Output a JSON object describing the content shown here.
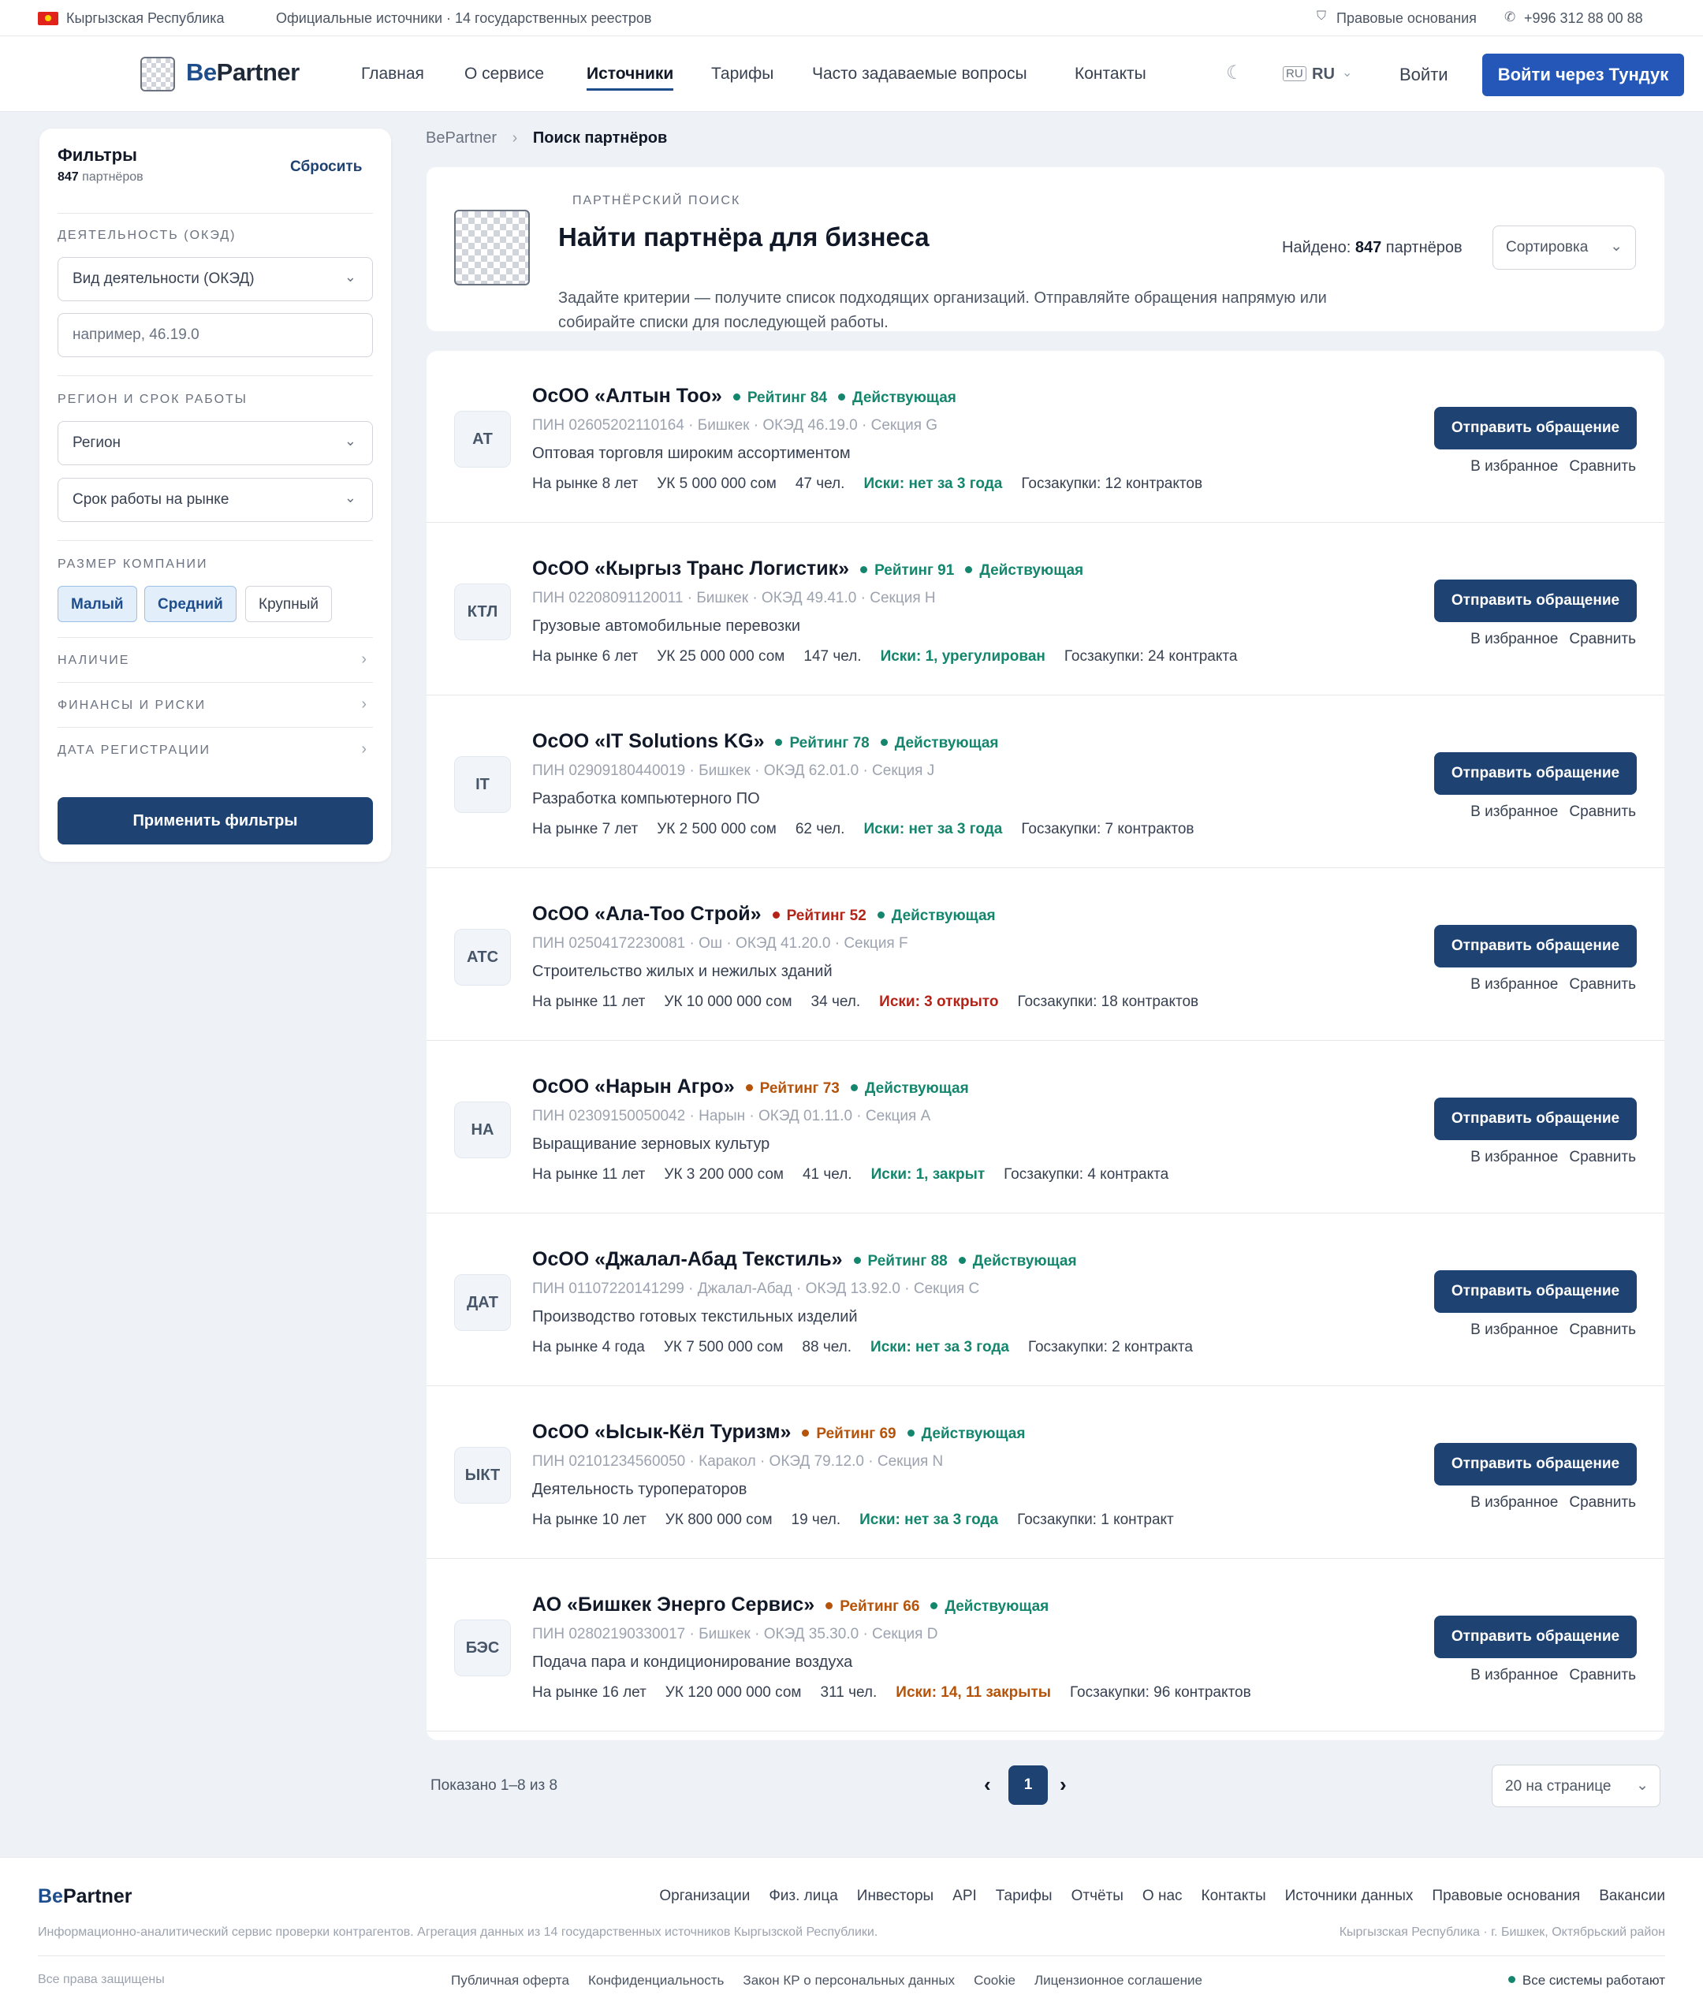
{
  "topbar": {
    "country": "Кыргызская Республика",
    "sources": "Официальные источники · 14 государственных реестров",
    "legal": "Правовые основания",
    "phone": "+996 312 88 00 88"
  },
  "header": {
    "logo_be": "Be",
    "logo_partner": "Partner",
    "nav": [
      "Главная",
      "О сервисе",
      "Источники",
      "Тарифы",
      "Часто задаваемые вопросы",
      "Контакты"
    ],
    "lang": "RU",
    "login": "Войти",
    "login_tunduk": "Войти через Тундук"
  },
  "filters": {
    "title": "Фильтры",
    "count_num": "847",
    "count_label": "партнёров",
    "reset": "Сбросить",
    "section_activity": "ДЕЯТЕЛЬНОСТЬ (ОКЭД)",
    "activity_select": "Вид деятельности (ОКЭД)",
    "activity_placeholder": "например, 46.19.0",
    "section_region": "РЕГИОН И СРОК РАБОТЫ",
    "region_select": "Регион",
    "term_select": "Срок работы на рынке",
    "section_size": "РАЗМЕР КОМПАНИИ",
    "sizes": [
      "Малый",
      "Средний",
      "Крупный"
    ],
    "acc_availability": "НАЛИЧИЕ",
    "acc_finance": "ФИНАНСЫ И РИСКИ",
    "acc_date": "ДАТА РЕГИСТРАЦИИ",
    "apply": "Применить фильтры"
  },
  "breadcrumb": {
    "root": "BePartner",
    "current": "Поиск партнёров"
  },
  "search_head": {
    "eyebrow": "ПАРТНЁРСКИЙ ПОИСК",
    "title": "Найти партнёра для бизнеса",
    "found_label": "Найдено:",
    "found_num": "847",
    "found_unit": "партнёров",
    "sort": "Сортировка",
    "desc_line1": "Задайте критерии — получите список подходящих организаций. Отправляйте обращения напрямую или",
    "desc_line2": "собирайте списки для последующей работы."
  },
  "actions": {
    "send": "Отправить обращение",
    "favorite": "В избранное",
    "compare": "Сравнить"
  },
  "companies": [
    {
      "abbr": "АТ",
      "name": "ОсОО «Алтын Тоо»",
      "rating": "Рейтинг 84",
      "rating_color": "#14866d",
      "status": "Действующая",
      "meta": "ПИН 02605202110164 · Бишкек · ОКЭД 46.19.0 · Секция G",
      "desc": "Оптовая торговля широким ассортиментом",
      "years": "На рынке 8 лет",
      "capital": "УК 5 000 000 сом",
      "staff": "47 чел.",
      "suits": "Иски: нет за 3 года",
      "suits_color": "#14866d",
      "tenders": "Госзакупки: 12 контрактов"
    },
    {
      "abbr": "КТЛ",
      "name": "ОсОО «Кыргыз Транс Логистик»",
      "rating": "Рейтинг 91",
      "rating_color": "#14866d",
      "status": "Действующая",
      "meta": "ПИН 02208091120011 · Бишкек · ОКЭД 49.41.0 · Секция H",
      "desc": "Грузовые автомобильные перевозки",
      "years": "На рынке 6 лет",
      "capital": "УК 25 000 000 сом",
      "staff": "147 чел.",
      "suits": "Иски: 1, урегулирован",
      "suits_color": "#14866d",
      "tenders": "Госзакупки: 24 контракта"
    },
    {
      "abbr": "IT",
      "name": "ОсОО «IT Solutions KG»",
      "rating": "Рейтинг 78",
      "rating_color": "#14866d",
      "status": "Действующая",
      "meta": "ПИН 02909180440019 · Бишкек · ОКЭД 62.01.0 · Секция J",
      "desc": "Разработка компьютерного ПО",
      "years": "На рынке 7 лет",
      "capital": "УК 2 500 000 сом",
      "staff": "62 чел.",
      "suits": "Иски: нет за 3 года",
      "suits_color": "#14866d",
      "tenders": "Госзакупки: 7 контрактов"
    },
    {
      "abbr": "АТС",
      "name": "ОсОО «Ала-Тоо Строй»",
      "rating": "Рейтинг 52",
      "rating_color": "#b42318",
      "status": "Действующая",
      "meta": "ПИН 02504172230081 · Ош · ОКЭД 41.20.0 · Секция F",
      "desc": "Строительство жилых и нежилых зданий",
      "years": "На рынке 11 лет",
      "capital": "УК 10 000 000 сом",
      "staff": "34 чел.",
      "suits": "Иски: 3 открыто",
      "suits_color": "#b42318",
      "tenders": "Госзакупки: 18 контрактов"
    },
    {
      "abbr": "НА",
      "name": "ОсОО «Нарын Агро»",
      "rating": "Рейтинг 73",
      "rating_color": "#b45309",
      "status": "Действующая",
      "meta": "ПИН 02309150050042 · Нарын · ОКЭД 01.11.0 · Секция A",
      "desc": "Выращивание зерновых культур",
      "years": "На рынке 11 лет",
      "capital": "УК 3 200 000 сом",
      "staff": "41 чел.",
      "suits": "Иски: 1, закрыт",
      "suits_color": "#14866d",
      "tenders": "Госзакупки: 4 контракта"
    },
    {
      "abbr": "ДАТ",
      "name": "ОсОО «Джалал-Абад Текстиль»",
      "rating": "Рейтинг 88",
      "rating_color": "#14866d",
      "status": "Действующая",
      "meta": "ПИН 01107220141299 · Джалал-Абад · ОКЭД 13.92.0 · Секция C",
      "desc": "Производство готовых текстильных изделий",
      "years": "На рынке 4 года",
      "capital": "УК 7 500 000 сом",
      "staff": "88 чел.",
      "suits": "Иски: нет за 3 года",
      "suits_color": "#14866d",
      "tenders": "Госзакупки: 2 контракта"
    },
    {
      "abbr": "ЫКТ",
      "name": "ОсОО «Ысык-Кёл Туризм»",
      "rating": "Рейтинг 69",
      "rating_color": "#b45309",
      "status": "Действующая",
      "meta": "ПИН 02101234560050 · Каракол · ОКЭД 79.12.0 · Секция N",
      "desc": "Деятельность туроператоров",
      "years": "На рынке 10 лет",
      "capital": "УК 800 000 сом",
      "staff": "19 чел.",
      "suits": "Иски: нет за 3 года",
      "suits_color": "#14866d",
      "tenders": "Госзакупки: 1 контракт"
    },
    {
      "abbr": "БЭС",
      "name": "АО «Бишкек Энерго Сервис»",
      "rating": "Рейтинг 66",
      "rating_color": "#b45309",
      "status": "Действующая",
      "meta": "ПИН 02802190330017 · Бишкек · ОКЭД 35.30.0 · Секция D",
      "desc": "Подача пара и кондиционирование воздуха",
      "years": "На рынке 16 лет",
      "capital": "УК 120 000 000 сом",
      "staff": "311 чел.",
      "suits": "Иски: 14, 11 закрыты",
      "suits_color": "#b45309",
      "tenders": "Госзакупки: 96 контрактов"
    }
  ],
  "pagination": {
    "shown": "Показано 1–8 из 8",
    "current": "1",
    "per_page": "20 на странице"
  },
  "footer": {
    "logo_be": "Be",
    "logo_partner": "Partner",
    "links": [
      "Организации",
      "Физ. лица",
      "Инвесторы",
      "API",
      "Тарифы",
      "Отчёты",
      "О нас",
      "Контакты",
      "Источники данных",
      "Правовые основания",
      "Вакансии"
    ],
    "about": "Информационно-аналитический сервис проверки контрагентов. Агрегация данных из 14 государственных источников Кыргызской Республики.",
    "address": "Кыргызская Республика · г. Бишкек, Октябрьский район",
    "rights": "Все права защищены",
    "legal_links": [
      "Публичная оферта",
      "Конфиденциальность",
      "Закон КР о персональных данных",
      "Cookie",
      "Лицензионное соглашение"
    ],
    "status": "Все системы работают"
  }
}
